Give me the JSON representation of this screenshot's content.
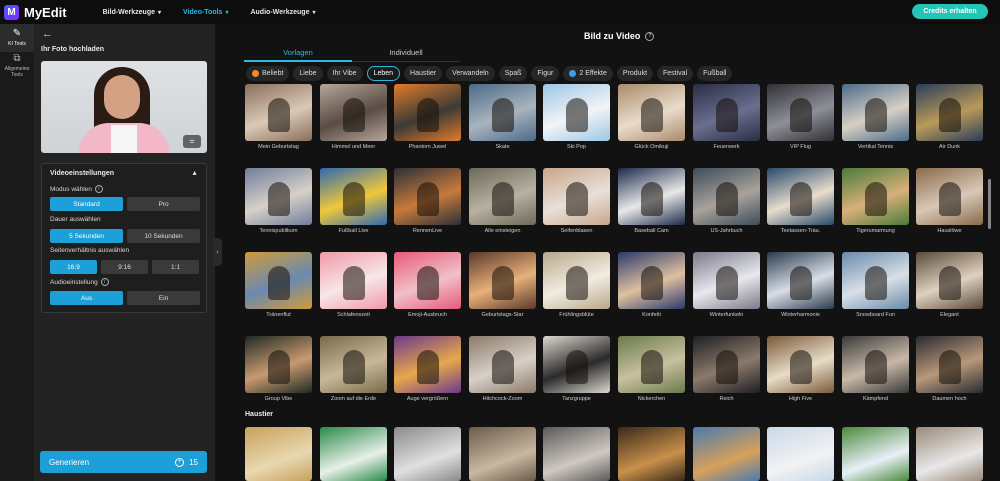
{
  "app": {
    "name": "MyEdit",
    "logo_letter": "M"
  },
  "nav": [
    {
      "label": "Bild-Werkzeuge",
      "active": false
    },
    {
      "label": "Video-Tools",
      "active": true
    },
    {
      "label": "Audio-Werkzeuge",
      "active": false
    }
  ],
  "credits_button": "Credits erhalten",
  "rail": [
    {
      "label": "KI Tools",
      "icon": "magic-wand-icon",
      "active": true
    },
    {
      "label": "Allgemeine Tools",
      "icon": "layers-icon",
      "active": false
    }
  ],
  "panel": {
    "upload_label": "Ihr Foto hochladen",
    "settings": {
      "title": "Videoeinstellungen",
      "mode_label": "Modus wählen",
      "mode_options": [
        "Standard",
        "Pro"
      ],
      "mode_selected": 0,
      "duration_label": "Dauer auswählen",
      "duration_options": [
        "5 Sekunden",
        "10 Sekunden"
      ],
      "duration_selected": 0,
      "ratio_label": "Seitenverhältnis auswählen",
      "ratio_options": [
        "16:9",
        "9:16",
        "1:1"
      ],
      "ratio_selected": 0,
      "audio_label": "Audioeinstellung",
      "audio_options": [
        "Aus",
        "Ein"
      ],
      "audio_selected": 0
    },
    "generate_label": "Generieren",
    "generate_cost": "15"
  },
  "main": {
    "title": "Bild zu Video",
    "tabs": [
      {
        "label": "Vorlagen",
        "active": true
      },
      {
        "label": "Individuell",
        "active": false
      }
    ],
    "chips": [
      {
        "label": "Beliebt",
        "dot": "#f08a2a"
      },
      {
        "label": "Liebe"
      },
      {
        "label": "Ihr Vibe"
      },
      {
        "label": "Leben",
        "active": true
      },
      {
        "label": "Haustier"
      },
      {
        "label": "Verwandeln"
      },
      {
        "label": "Spaß"
      },
      {
        "label": "Figur"
      },
      {
        "label": "2 Effekte",
        "dot": "#3aa0e8"
      },
      {
        "label": "Produkt"
      },
      {
        "label": "Festival"
      },
      {
        "label": "Fußball"
      }
    ],
    "rows": [
      [
        "Mein Geburtstag",
        "Himmel und Meer",
        "Phantom Juwel",
        "Skate",
        "Ski Pop",
        "Glück Omikuji",
        "Feuerwerk",
        "VIP Flug",
        "Vertikal Tennis",
        "Air Dunk"
      ],
      [
        "Tennispublikum",
        "Fußball Live",
        "RennenLive",
        "Alle einsteigen",
        "Seifenblasen",
        "Baseball Cam",
        "US-Jahrbuch",
        "Teetassen-Träu.",
        "Tigerumarmung",
        "Hauslöwe"
      ],
      [
        "Tränenflut",
        "Schlafenszeit",
        "Emoji-Ausbruch",
        "Geburtstags-Star",
        "Frühlingsblüte",
        "Konfetti",
        "Winterfunkeln",
        "Winterharmonie",
        "Snowboard Fun",
        "Elegant"
      ],
      [
        "Group Vibe",
        "Zoom auf die Erde",
        "Auge vergrößern",
        "Hitchcock-Zoom",
        "Tanzgruppe",
        "Nickerchen",
        "Reich",
        "High Five",
        "Kämpfend",
        "Daumen hoch"
      ]
    ],
    "section_label": "Haustier",
    "colors": {
      "accent": "#1d9fd8",
      "credits": "#25c5b5"
    }
  }
}
